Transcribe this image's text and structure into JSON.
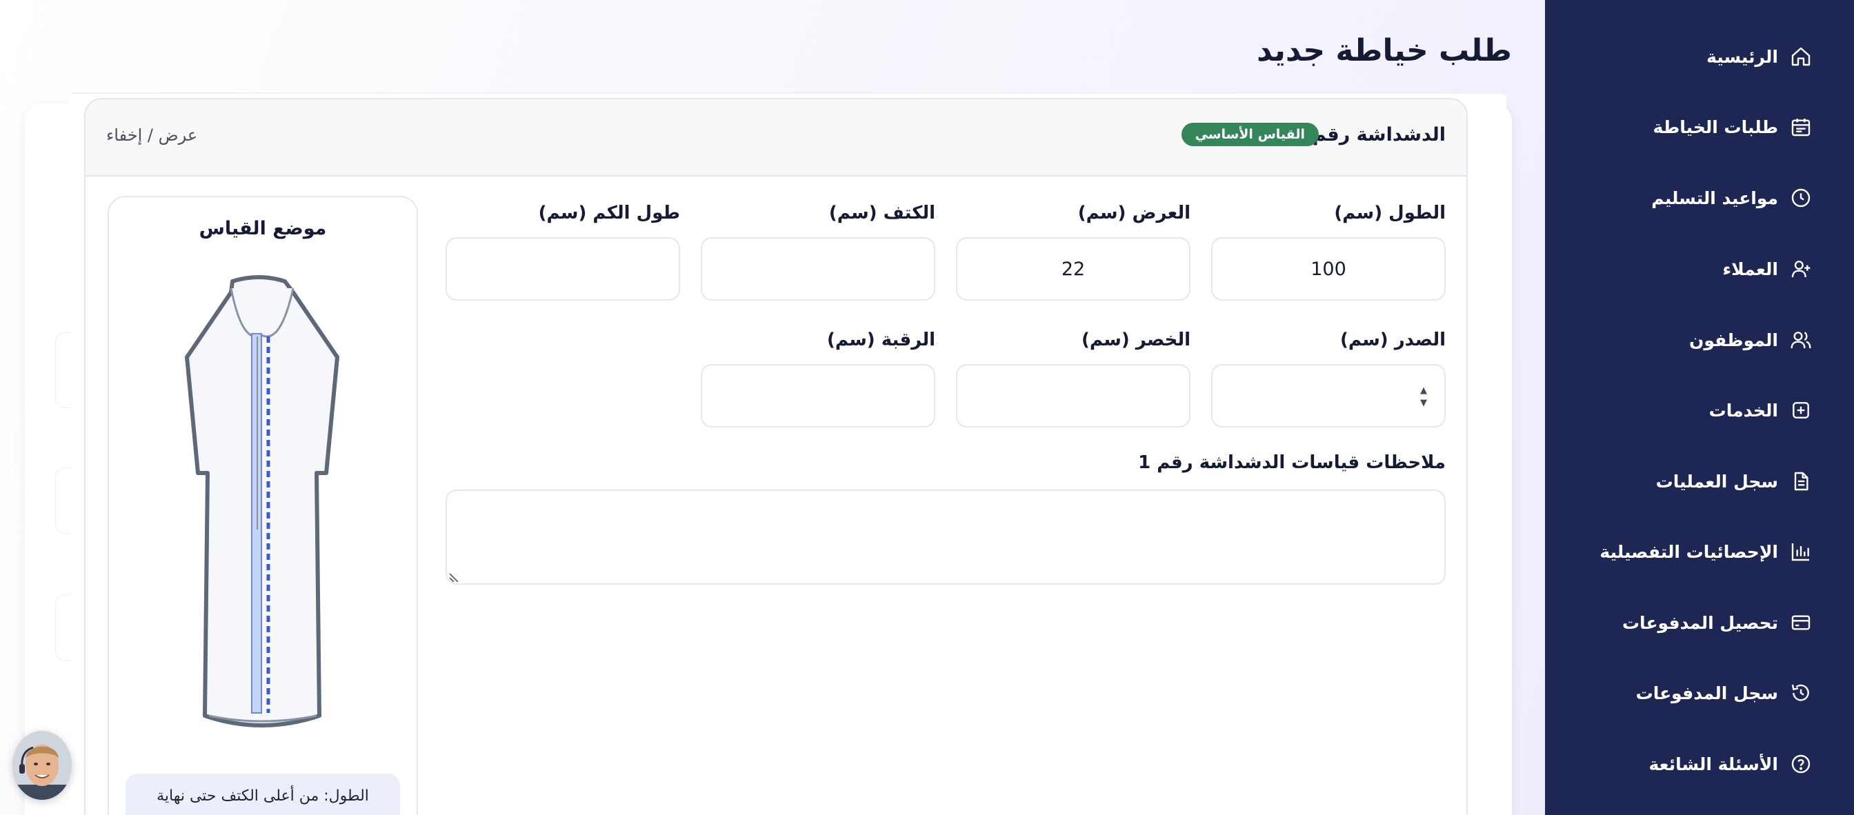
{
  "page": {
    "title": "طلب خياطة جديد"
  },
  "sidebar": {
    "items": [
      {
        "label": "الرئيسية",
        "icon": "home-icon"
      },
      {
        "label": "طلبات الخياطة",
        "icon": "calendar-icon"
      },
      {
        "label": "مواعيد التسليم",
        "icon": "clock-icon"
      },
      {
        "label": "العملاء",
        "icon": "user-plus-icon"
      },
      {
        "label": "الموظفون",
        "icon": "users-icon"
      },
      {
        "label": "الخدمات",
        "icon": "plus-square-icon"
      },
      {
        "label": "سجل العمليات",
        "icon": "document-icon"
      },
      {
        "label": "الإحصائيات التفصيلية",
        "icon": "bar-chart-icon"
      },
      {
        "label": "تحصيل المدفوعات",
        "icon": "credit-card-icon"
      },
      {
        "label": "سجل المدفوعات",
        "icon": "history-icon"
      },
      {
        "label": "الأسئلة الشائعة",
        "icon": "help-circle-icon"
      }
    ]
  },
  "card": {
    "title": "الدشداشة رقم 1",
    "badge": "القياس الأساسي",
    "toggle_label": "عرض / إخفاء"
  },
  "fields": {
    "length": {
      "label": "الطول (سم)",
      "value": "100"
    },
    "width": {
      "label": "العرض (سم)",
      "value": "22"
    },
    "shoulder": {
      "label": "الكتف (سم)",
      "value": ""
    },
    "sleeve": {
      "label": "طول الكم (سم)",
      "value": ""
    },
    "chest": {
      "label": "الصدر (سم)",
      "value": ""
    },
    "waist": {
      "label": "الخصر (سم)",
      "value": ""
    },
    "neck": {
      "label": "الرقبة (سم)",
      "value": ""
    }
  },
  "notes": {
    "label": "ملاحظات قياسات الدشداشة رقم 1",
    "value": ""
  },
  "diagram": {
    "title": "موضع القياس",
    "note": "الطول: من أعلى الكتف حتى نهاية"
  },
  "colors": {
    "sidebar_bg": "#1e2653",
    "badge_bg": "#34855a",
    "measure_line": "#3b5bd6"
  }
}
